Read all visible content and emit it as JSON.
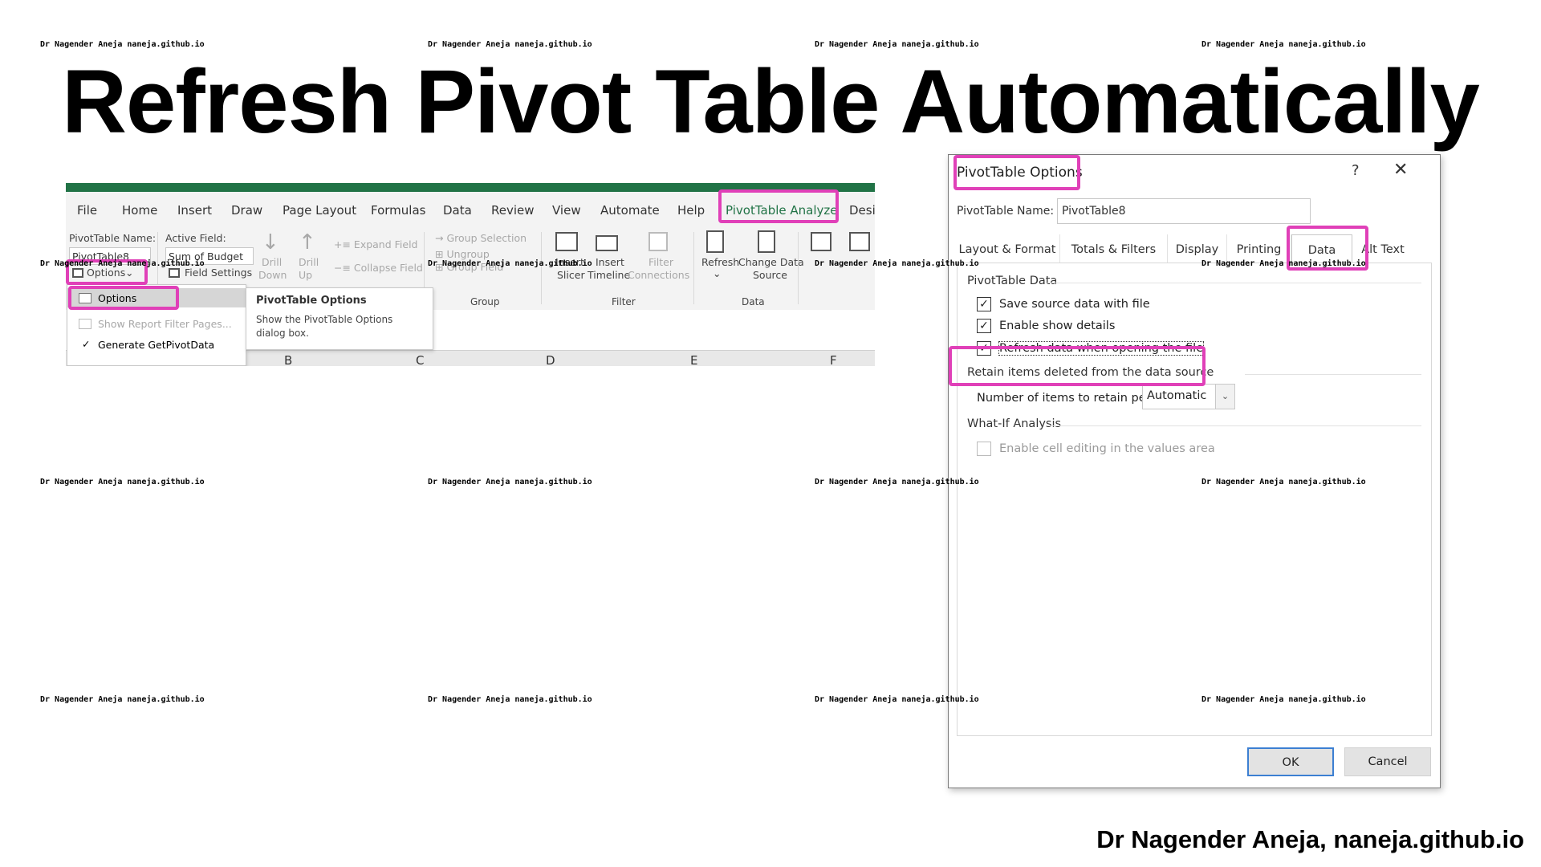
{
  "slide": {
    "title": "Refresh Pivot Table Automatically",
    "footer": "Dr Nagender Aneja, naneja.github.io",
    "watermark": "Dr Nagender Aneja naneja.github.io"
  },
  "excel": {
    "menu": [
      "File",
      "Home",
      "Insert",
      "Draw",
      "Page Layout",
      "Formulas",
      "Data",
      "Review",
      "View",
      "Automate",
      "Help",
      "PivotTable Analyze",
      "Desi"
    ],
    "active_tab": "PivotTable Analyze",
    "ribbon": {
      "pivot_name_label": "PivotTable Name:",
      "pivot_name_value": "PivotTable8",
      "options_label": "Options",
      "active_field_label": "Active Field:",
      "active_field_value": "Sum of Budget",
      "field_settings": "Field Settings",
      "drill_down": [
        "Drill",
        "Down"
      ],
      "drill_up": [
        "Drill",
        "Up"
      ],
      "expand_field": "Expand Field",
      "collapse_field": "Collapse Field",
      "group_selection": "Group Selection",
      "ungroup": "Ungroup",
      "group_field": "Group Field",
      "group_label": "Group",
      "insert_slicer": [
        "Insert",
        "Slicer"
      ],
      "insert_timeline": [
        "Insert",
        "Timeline"
      ],
      "filter_connections": [
        "Filter",
        "Connections"
      ],
      "filter_label": "Filter",
      "refresh": "Refresh",
      "change_data_source": [
        "Change Data",
        "Source"
      ],
      "data_label": "Data"
    },
    "dropdown": {
      "options": "Options",
      "show_report_filter_pages": "Show Report Filter Pages...",
      "generate_getpivotdata": "Generate GetPivotData"
    },
    "tooltip": {
      "title": "PivotTable Options",
      "body": "Show the PivotTable Options dialog box."
    },
    "column_headers": [
      "B",
      "C",
      "D",
      "E",
      "F"
    ]
  },
  "dialog": {
    "title": "PivotTable Options",
    "help": "?",
    "close": "✕",
    "name_label": "PivotTable Name:",
    "name_value": "PivotTable8",
    "tabs": [
      "Layout & Format",
      "Totals & Filters",
      "Display",
      "Printing",
      "Data",
      "Alt Text"
    ],
    "active_tab": "Data",
    "section_pivot_data": "PivotTable Data",
    "save_source": "Save source data with file",
    "enable_show_details": "Enable show details",
    "refresh_on_open": "Refresh data when opening the file",
    "section_retain": "Retain items deleted from the data source",
    "retain_label": "Number of items to retain per field:",
    "retain_value": "Automatic",
    "section_whatif": "What-If Analysis",
    "enable_cell_editing": "Enable cell editing in the values area",
    "ok": "OK",
    "cancel": "Cancel",
    "checked": {
      "save_source": true,
      "enable_show_details": true,
      "refresh_on_open": true,
      "enable_cell_editing": false
    }
  },
  "colors": {
    "excel_green": "#217346",
    "highlight": "#e040b8",
    "ok_border": "#3c7fd2"
  }
}
